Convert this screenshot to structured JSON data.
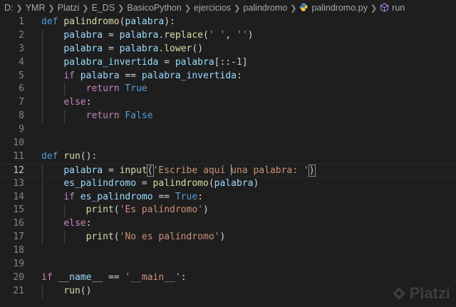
{
  "breadcrumb": {
    "items": [
      "D:",
      "YMR",
      "Platzi",
      "E_DS",
      "BasicoPython",
      "ejercicios",
      "palindromo",
      "palindromo.py",
      "run"
    ]
  },
  "editor": {
    "current_line": 12,
    "lines": [
      {
        "n": "1",
        "t": "def palindromo(palabra):"
      },
      {
        "n": "2",
        "t": "    palabra = palabra.replace(' ', '')"
      },
      {
        "n": "3",
        "t": "    palabra = palabra.lower()"
      },
      {
        "n": "4",
        "t": "    palabra_invertida = palabra[::-1]"
      },
      {
        "n": "5",
        "t": "    if palabra == palabra_invertida:"
      },
      {
        "n": "6",
        "t": "        return True"
      },
      {
        "n": "7",
        "t": "    else:"
      },
      {
        "n": "8",
        "t": "        return False"
      },
      {
        "n": "9",
        "t": ""
      },
      {
        "n": "10",
        "t": ""
      },
      {
        "n": "11",
        "t": "def run():"
      },
      {
        "n": "12",
        "t": "    palabra = input('Escribe aquí una palabra: ')"
      },
      {
        "n": "13",
        "t": "    es_palindromo = palindromo(palabra)"
      },
      {
        "n": "14",
        "t": "    if es_palindromo == True:"
      },
      {
        "n": "15",
        "t": "        print('Es palíndromo')"
      },
      {
        "n": "16",
        "t": "    else:"
      },
      {
        "n": "17",
        "t": "        print('No es palíndromo')"
      },
      {
        "n": "18",
        "t": ""
      },
      {
        "n": "19",
        "t": ""
      },
      {
        "n": "20",
        "t": "if __name__ == '__main__':"
      },
      {
        "n": "21",
        "t": "    run()"
      }
    ]
  },
  "watermark": {
    "text": "Platzi",
    "icon": "platzi-logo-icon"
  },
  "colors": {
    "background": "#1e1e1e",
    "keyword": "#569cd6",
    "control": "#c586c0",
    "function": "#dcdcaa",
    "variable": "#9cdcfe",
    "string": "#ce9178",
    "number": "#b5cea8"
  }
}
